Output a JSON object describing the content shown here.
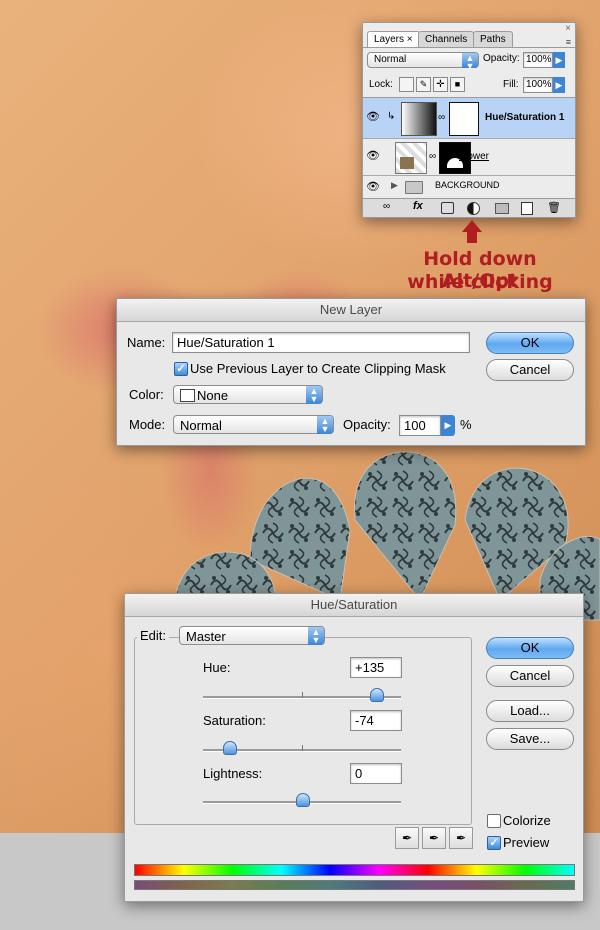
{
  "annotation": {
    "line1": "Hold down Alt/Opt",
    "line2": "while clicking",
    "color": "#b01e22"
  },
  "layers_panel": {
    "tabs": [
      "Layers",
      "Channels",
      "Paths"
    ],
    "blend_mode": "Normal",
    "opacity_label": "Opacity:",
    "opacity_value": "100%",
    "lock_label": "Lock:",
    "fill_label": "Fill:",
    "fill_value": "100%",
    "layers": [
      {
        "name": "Hue/Saturation 1",
        "selected": true
      },
      {
        "name": "Flower",
        "selected": false
      },
      {
        "name": "BACKGROUND",
        "selected": false
      }
    ],
    "fx_label": "fx"
  },
  "new_layer": {
    "title": "New Layer",
    "name_label": "Name:",
    "name_value": "Hue/Saturation 1",
    "clip_label": "Use Previous Layer to Create Clipping Mask",
    "clip_checked": true,
    "color_label": "Color:",
    "color_value": "None",
    "mode_label": "Mode:",
    "mode_value": "Normal",
    "opacity_label": "Opacity:",
    "opacity_value": "100",
    "percent": "%",
    "ok": "OK",
    "cancel": "Cancel"
  },
  "hue_sat": {
    "title": "Hue/Saturation",
    "edit_label": "Edit:",
    "edit_value": "Master",
    "hue_label": "Hue:",
    "hue_value": "+135",
    "hue_fraction": 0.875,
    "sat_label": "Saturation:",
    "sat_value": "-74",
    "sat_fraction": 0.13,
    "light_label": "Lightness:",
    "light_value": "0",
    "light_fraction": 0.5,
    "ok": "OK",
    "cancel": "Cancel",
    "load": "Load...",
    "save": "Save...",
    "colorize_label": "Colorize",
    "colorize_checked": false,
    "preview_label": "Preview",
    "preview_checked": true
  }
}
